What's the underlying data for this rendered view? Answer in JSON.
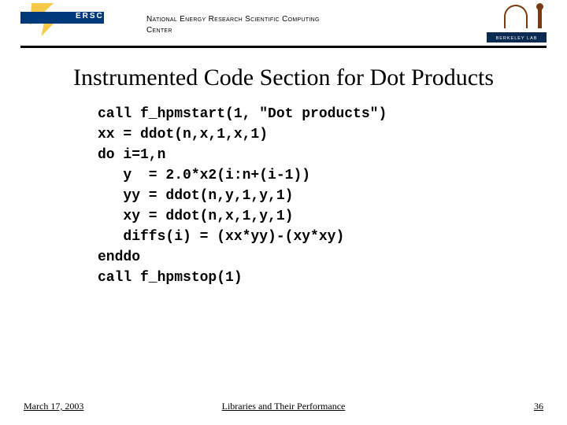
{
  "header": {
    "nersc_acronym": "ERSC",
    "center_line1": "National Energy Research Scientific Computing",
    "center_line2": "Center",
    "lab_label": "BERKELEY LAB"
  },
  "title": "Instrumented Code Section for Dot Products",
  "code_lines": [
    "call f_hpmstart(1, \"Dot products\")",
    "xx = ddot(n,x,1,x,1)",
    "do i=1,n",
    "   y  = 2.0*x2(i:n+(i-1))",
    "   yy = ddot(n,y,1,y,1)",
    "   xy = ddot(n,x,1,y,1)",
    "   diffs(i) = (xx*yy)-(xy*xy)",
    "enddo",
    "call f_hpmstop(1)"
  ],
  "footer": {
    "date": "March 17, 2003",
    "middle": "Libraries and Their Performance",
    "page": "36"
  }
}
